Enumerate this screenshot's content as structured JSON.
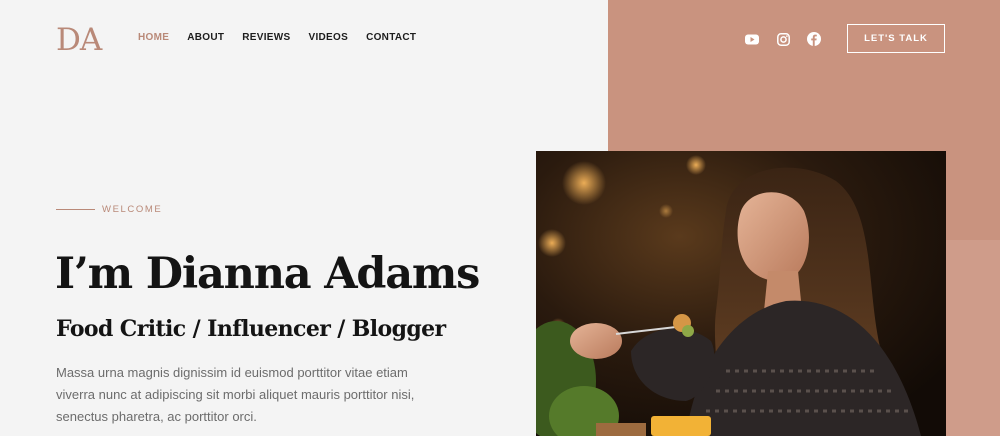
{
  "brand": {
    "logo": "DA"
  },
  "nav": {
    "items": [
      {
        "label": "HOME",
        "active": true
      },
      {
        "label": "ABOUT"
      },
      {
        "label": "REVIEWS"
      },
      {
        "label": "VIDEOS"
      },
      {
        "label": "CONTACT"
      }
    ]
  },
  "social": [
    "youtube-icon",
    "instagram-icon",
    "facebook-icon"
  ],
  "header": {
    "cta_label": "LET'S TALK"
  },
  "hero": {
    "eyebrow": "WELCOME",
    "title": "I’m Dianna Adams",
    "subtitle": "Food Critic / Influencer / Blogger",
    "description": "Massa urna magnis dignissim id euismod porttitor vitae etiam viverra nunc at adipiscing sit morbi aliquet mauris porttitor nisi, senectus pharetra, ac porttitor orci."
  },
  "colors": {
    "accent": "#b98978",
    "panel": "#c9937f",
    "background": "#f4f4f4",
    "text": "#141414"
  }
}
